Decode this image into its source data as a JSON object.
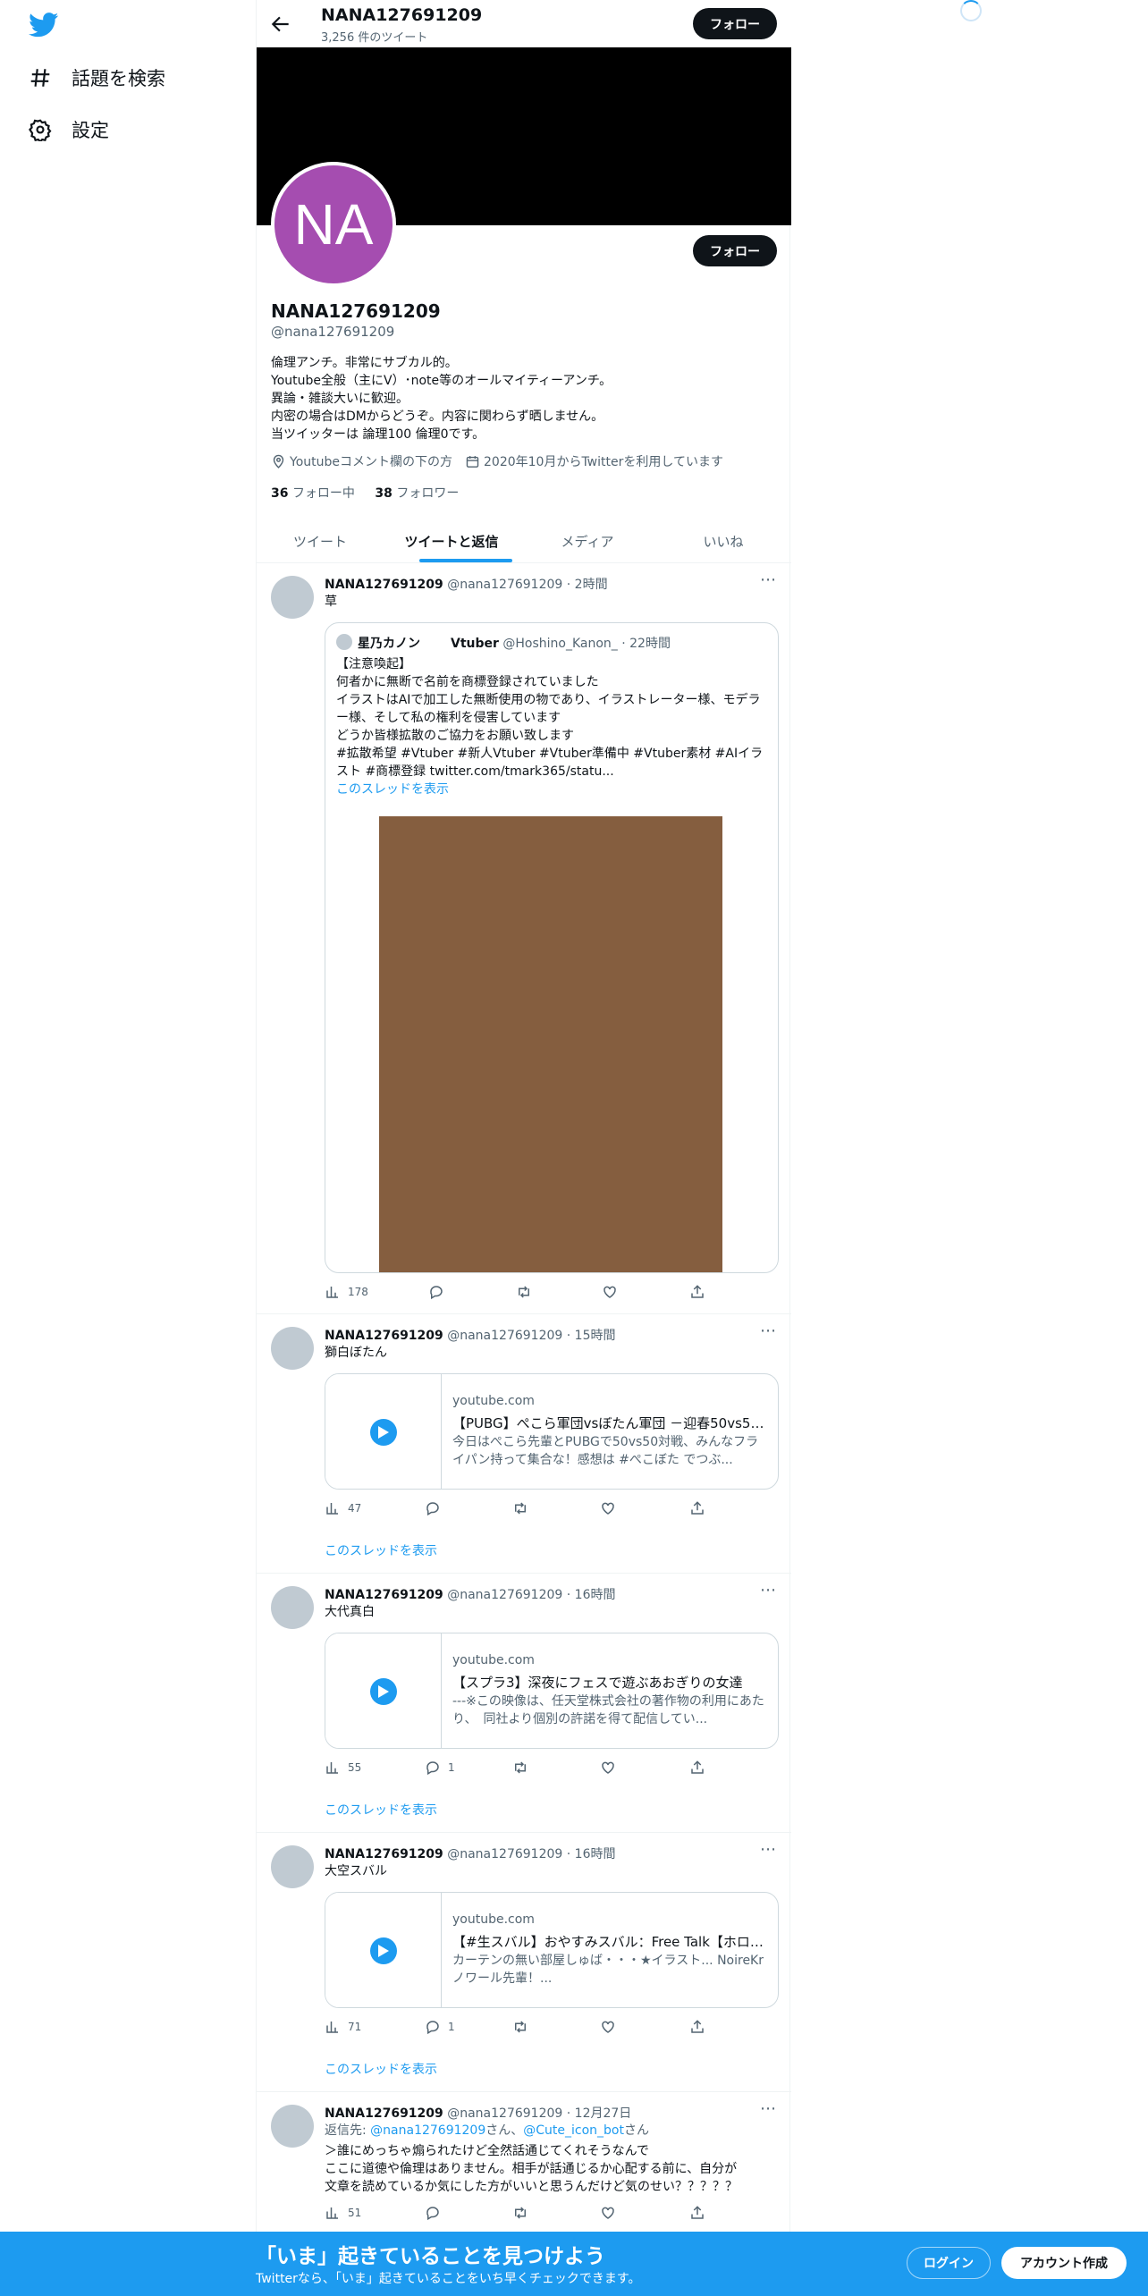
{
  "sidebar": {
    "items": [
      {
        "label": "話題を検索",
        "icon": "hashtag-icon"
      },
      {
        "label": "設定",
        "icon": "gear-icon"
      }
    ]
  },
  "header": {
    "name": "NANA127691209",
    "tweet_count": "3,256 件のツイート",
    "follow_label": "フォロー"
  },
  "profile": {
    "avatar_initials": "NA",
    "avatar_color": "#a54db0",
    "name": "NANA127691209",
    "handle": "@nana127691209",
    "follow_label": "フォロー",
    "bio": [
      "倫理アンチ。非常にサブカル的。",
      "Youtube全般（主にV）･note等のオールマイティーアンチ。",
      "異論・雑談大いに歓迎。",
      "内密の場合はDMからどうぞ。内容に関わらず晒しません。",
      "当ツイッターは 論理100 倫理0です。"
    ],
    "location": "Youtubeコメント欄の下の方",
    "joined": "2020年10月からTwitterを利用しています",
    "following_count": "36",
    "following_label": "フォロー中",
    "followers_count": "38",
    "followers_label": "フォロワー"
  },
  "tabs": [
    {
      "label": "ツイート",
      "active": false
    },
    {
      "label": "ツイートと返信",
      "active": true
    },
    {
      "label": "メディア",
      "active": false
    },
    {
      "label": "いいね",
      "active": false
    }
  ],
  "tweets": [
    {
      "name": "NANA127691209",
      "handle": "@nana127691209",
      "time": "· 2時間",
      "text": "草",
      "quote": {
        "name": "星乃カノン",
        "badge": "Vtuber",
        "handle": "@Hoshino_Kanon_",
        "time": "· 22時間",
        "lines": [
          "【注意喚起】",
          "何者かに無断で名前を商標登録されていました",
          "イラストはAIで加工した無断使用の物であり、イラストレーター様、モデラー様、そして私の権利を侵害しています",
          "どうか皆様拡散のご協力をお願い致します",
          "#拡散希望 #Vtuber #新人Vtuber #Vtuber準備中 #Vtuber素材 #AIイラスト #商標登録  twitter.com/tmark365/statu..."
        ],
        "thread_label": "このスレッドを表示"
      },
      "views": "178",
      "replies": "",
      "retweets": "",
      "likes": ""
    },
    {
      "name": "NANA127691209",
      "handle": "@nana127691209",
      "time": "· 15時間",
      "text": "獅白ぼたん",
      "card": {
        "domain": "youtube.com",
        "title": "【PUBG】ぺこら軍団vsぼたん軍団 －迎春50vs50...",
        "desc": "今日はぺこら先輩とPUBGで50vs50対戦、みんなフライパン持って集合な！感想は #ぺこぼた でつぶ..."
      },
      "views": "47",
      "replies": "",
      "retweets": "",
      "likes": "",
      "thread_label": "このスレッドを表示"
    },
    {
      "name": "NANA127691209",
      "handle": "@nana127691209",
      "time": "· 16時間",
      "text": "大代真白",
      "card": {
        "domain": "youtube.com",
        "title": "【スプラ3】深夜にフェスで遊ぶあおぎりの女達",
        "desc": "---※この映像は、任天堂株式会社の著作物の利用にあたり、　同社より個別の許諾を得て配信してい..."
      },
      "views": "55",
      "replies": "1",
      "retweets": "",
      "likes": "",
      "thread_label": "このスレッドを表示"
    },
    {
      "name": "NANA127691209",
      "handle": "@nana127691209",
      "time": "· 16時間",
      "text": "大空スバル",
      "card": {
        "domain": "youtube.com",
        "title": "【#生スバル】おやすみスバル：Free Talk【ホロラ...",
        "desc": "カーテンの無い部屋しゅば・・・★イラスト... NoireKr ノワール先輩！..."
      },
      "views": "71",
      "replies": "1",
      "retweets": "",
      "likes": "",
      "thread_label": "このスレッドを表示"
    },
    {
      "name": "NANA127691209",
      "handle": "@nana127691209",
      "time": "· 12月27日",
      "reply_to_prefix": "返信先:",
      "reply_to_1": "@nana127691209",
      "reply_to_mid": "さん、",
      "reply_to_2": "@Cute_icon_bot",
      "reply_to_suffix": "さん",
      "lines": [
        "＞誰にめっちゃ煽られたけど全然話通じてくれそうなんで",
        "ここに道徳や倫理はありません。相手が話通じるか心配する前に、自分が",
        "文章を読めているか気にした方がいいと思うんだけど気のせい？？？？？"
      ],
      "views": "51",
      "replies": "",
      "retweets": "",
      "likes": ""
    }
  ],
  "bottom_bar": {
    "title": "「いま」起きていることを見つけよう",
    "subtitle": "Twitterなら、「いま」起きていることをいち早くチェックできます。",
    "login": "ログイン",
    "signup": "アカウント作成"
  },
  "colors": {
    "accent": "#1d9bf0",
    "text": "#0f1419",
    "muted": "#536471",
    "quote_image": "#855e3f"
  }
}
